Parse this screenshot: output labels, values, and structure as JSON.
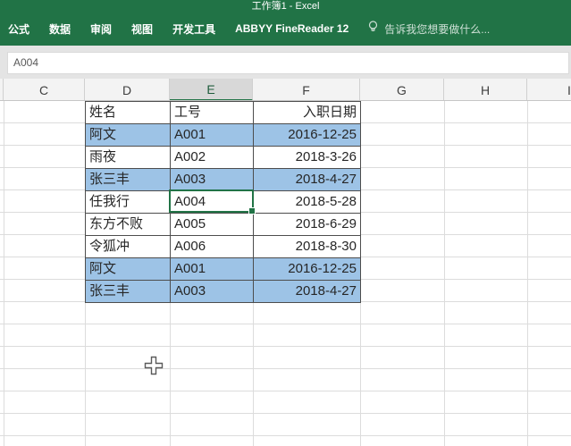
{
  "window": {
    "title": "工作簿1 - Excel"
  },
  "ribbon": {
    "tabs": [
      "公式",
      "数据",
      "审阅",
      "视图",
      "开发工具",
      "ABBYY FineReader 12"
    ],
    "tell_me": "告诉我您想要做什么...",
    "tell_me_icon": "lightbulb-icon"
  },
  "formula_bar": {
    "value": "A004"
  },
  "grid": {
    "column_headers": [
      "",
      "C",
      "D",
      "E",
      "F",
      "G",
      "H",
      "I"
    ],
    "selected_column": "E"
  },
  "sheet": {
    "headers": [
      "姓名",
      "工号",
      "入职日期"
    ],
    "rows": [
      {
        "name": "阿文",
        "id": "A001",
        "date": "2016-12-25",
        "highlighted": true
      },
      {
        "name": "雨夜",
        "id": "A002",
        "date": "2018-3-26",
        "highlighted": false
      },
      {
        "name": "张三丰",
        "id": "A003",
        "date": "2018-4-27",
        "highlighted": true
      },
      {
        "name": "任我行",
        "id": "A004",
        "date": "2018-5-28",
        "highlighted": false,
        "selected_cell": "id"
      },
      {
        "name": "东方不败",
        "id": "A005",
        "date": "2018-6-29",
        "highlighted": false
      },
      {
        "name": "令狐冲",
        "id": "A006",
        "date": "2018-8-30",
        "highlighted": false
      },
      {
        "name": "阿文",
        "id": "A001",
        "date": "2016-12-25",
        "highlighted": true
      },
      {
        "name": "张三丰",
        "id": "A003",
        "date": "2018-4-27",
        "highlighted": true
      }
    ]
  },
  "colors": {
    "accent_green": "#217346",
    "highlight_blue": "#9DC3E6",
    "selection_border": "#217346"
  }
}
